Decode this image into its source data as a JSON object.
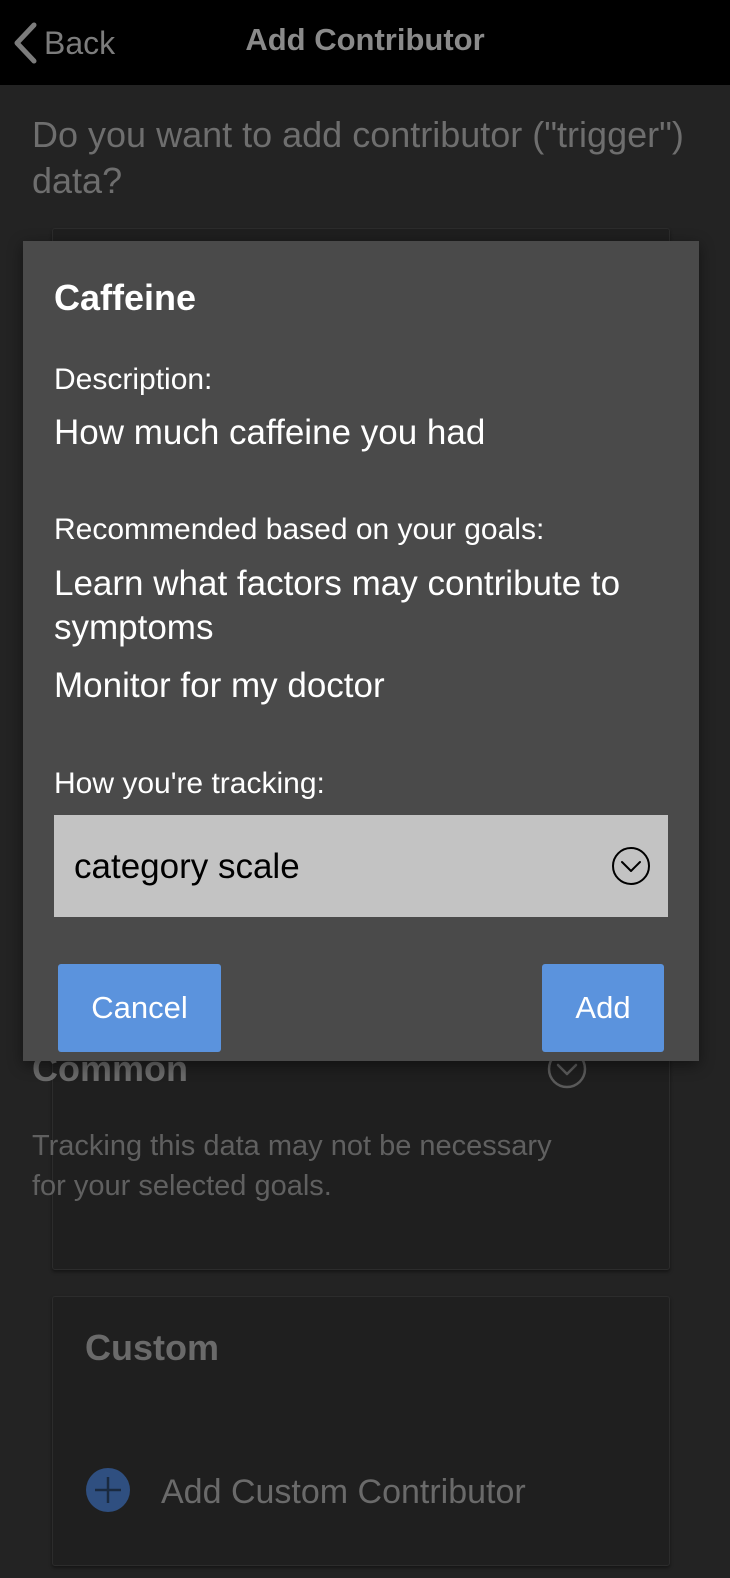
{
  "header": {
    "back_label": "Back",
    "title": "Add Contributor"
  },
  "question": "Do you want to add contributor (\"trigger\") data?",
  "common_section": {
    "title": "Common",
    "description": "Tracking this data may not be necessary for your selected goals."
  },
  "custom_section": {
    "title": "Custom",
    "add_label": "Add Custom Contributor"
  },
  "modal": {
    "title": "Caffeine",
    "description_label": "Description:",
    "description": "How much caffeine you had",
    "recommended_label": "Recommended based on your goals:",
    "goals": [
      "Learn what factors may contribute to symptoms",
      "Monitor for my doctor"
    ],
    "tracking_label": "How you're tracking:",
    "tracking_value": "category scale",
    "cancel_label": "Cancel",
    "add_label": "Add"
  },
  "icons": {
    "back": "chevron-left-icon",
    "select_chevron": "chevron-down-circle-icon",
    "add_custom": "plus-circle-icon"
  },
  "colors": {
    "accent": "#5b93dd",
    "modal_bg": "#4a4a4a",
    "page_bg": "#232323",
    "header_bg": "#000000"
  }
}
